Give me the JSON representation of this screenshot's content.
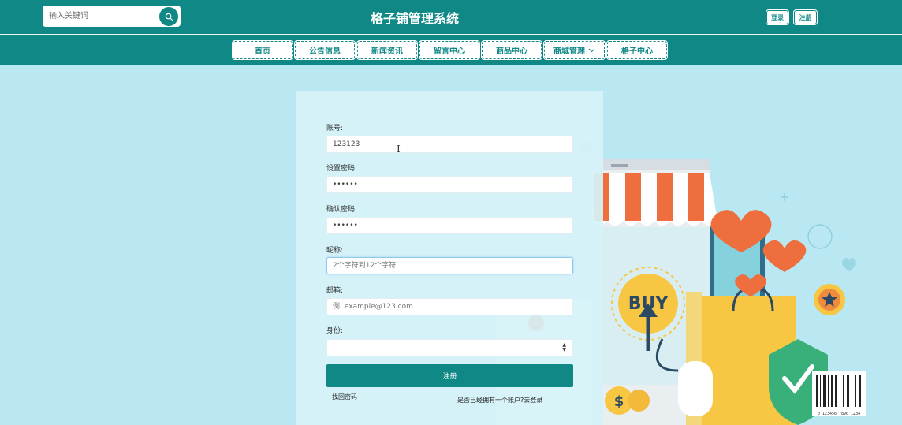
{
  "header": {
    "search_placeholder": "输入关键词",
    "title": "格子铺管理系统",
    "login_label": "登录",
    "register_label": "注册"
  },
  "nav": {
    "items": [
      {
        "label": "首页"
      },
      {
        "label": "公告信息"
      },
      {
        "label": "新闻资讯"
      },
      {
        "label": "留言中心"
      },
      {
        "label": "商品中心"
      },
      {
        "label": "商城管理"
      },
      {
        "label": "格子中心"
      }
    ]
  },
  "illustration": {
    "buy_text": "BUY",
    "barcode_text": "0 123456 7890 1234"
  },
  "form": {
    "account_label": "账号:",
    "account_value": "123123",
    "password_label": "设置密码:",
    "password_value": "123456",
    "confirm_label": "确认密码:",
    "confirm_value": "123456",
    "nickname_label": "昵称:",
    "nickname_placeholder": "2个字符到12个字符",
    "email_label": "邮箱:",
    "email_placeholder": "例: example@123.com",
    "role_label": "身份:",
    "role_value": "",
    "submit_label": "注册",
    "forgot_label": "找回密码",
    "have_account_label": "是否已经拥有一个账户?去登录"
  },
  "colors": {
    "primary": "#0f8886",
    "background": "#b9e7f2",
    "panel": "#d6f3f9"
  }
}
